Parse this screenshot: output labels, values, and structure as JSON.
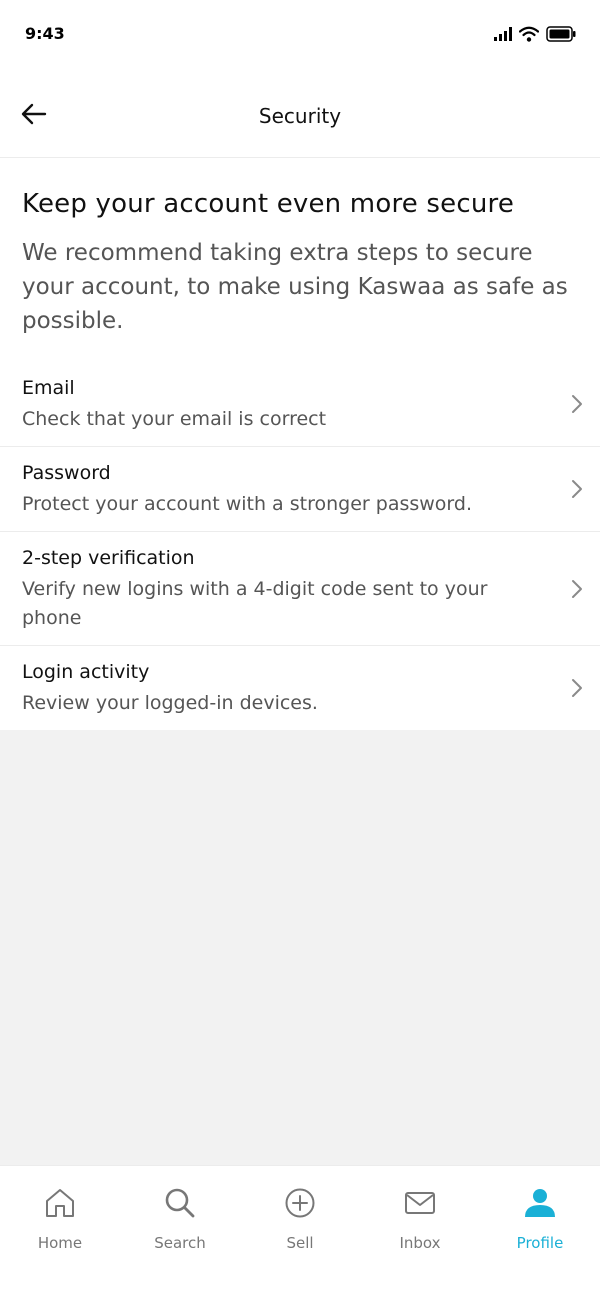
{
  "status_bar": {
    "time": "9:43"
  },
  "header": {
    "title": "Security"
  },
  "intro": {
    "heading": "Keep your account even more secure",
    "body": "We recommend taking extra steps to secure your account, to make using Kaswaa as safe as possible."
  },
  "options": [
    {
      "title": "Email",
      "subtitle": "Check that your email is correct"
    },
    {
      "title": "Password",
      "subtitle": "Protect your account with a stronger password."
    },
    {
      "title": "2-step verification",
      "subtitle": "Verify new logins with a 4-digit code sent to your phone"
    },
    {
      "title": "Login activity",
      "subtitle": "Review your logged-in devices."
    }
  ],
  "bottom_nav": {
    "items": [
      {
        "label": "Home",
        "icon": "home-icon"
      },
      {
        "label": "Search",
        "icon": "search-icon"
      },
      {
        "label": "Sell",
        "icon": "plus-circle-icon"
      },
      {
        "label": "Inbox",
        "icon": "mail-icon"
      },
      {
        "label": "Profile",
        "icon": "user-icon"
      }
    ],
    "active_index": 4
  },
  "colors": {
    "accent": "#1ab0d6",
    "text_primary": "#111111",
    "text_secondary": "#555555",
    "background": "#f2f2f2"
  }
}
